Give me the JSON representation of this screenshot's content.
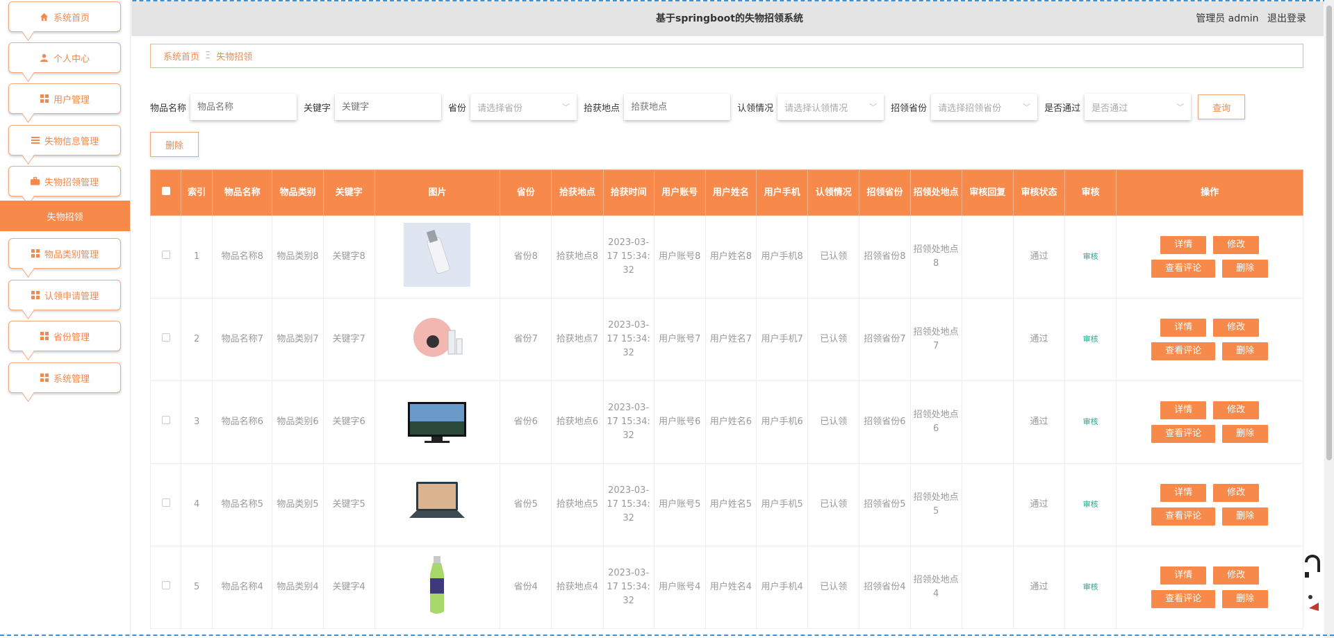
{
  "app": {
    "title": "基于springboot的失物招领系统"
  },
  "header": {
    "user_label": "管理员 admin",
    "logout_label": "退出登录"
  },
  "sidebar": {
    "items": [
      {
        "label": "系统首页",
        "icon": "home-icon"
      },
      {
        "label": "个人中心",
        "icon": "user-icon"
      },
      {
        "label": "用户管理",
        "icon": "grid-icon"
      },
      {
        "label": "失物信息管理",
        "icon": "list-icon"
      },
      {
        "label": "失物招领管理",
        "icon": "briefcase-icon"
      },
      {
        "label": "物品类别管理",
        "icon": "grid-icon"
      },
      {
        "label": "认领申请管理",
        "icon": "grid-icon"
      },
      {
        "label": "省份管理",
        "icon": "grid-icon"
      },
      {
        "label": "系统管理",
        "icon": "grid-icon"
      }
    ],
    "active_sub": "失物招领"
  },
  "breadcrumb": {
    "home": "系统首页",
    "separator": "Ξ",
    "current": "失物招领"
  },
  "search": {
    "name_label": "物品名称",
    "name_placeholder": "物品名称",
    "keyword_label": "关键字",
    "keyword_placeholder": "关键字",
    "province_label": "省份",
    "province_placeholder": "请选择省份",
    "location_label": "拾获地点",
    "location_placeholder": "拾获地点",
    "claim_label": "认领情况",
    "claim_placeholder": "请选择认领情况",
    "claim_province_label": "招领省份",
    "claim_province_placeholder": "请选择招领省份",
    "pass_label": "是否通过",
    "pass_placeholder": "是否通过",
    "query_button": "查询"
  },
  "actions": {
    "delete_button": "删除"
  },
  "table": {
    "headers": [
      "索引",
      "物品名称",
      "物品类别",
      "关键字",
      "图片",
      "省份",
      "拾获地点",
      "拾获时间",
      "用户账号",
      "用户姓名",
      "用户手机",
      "认领情况",
      "招领省份",
      "招领处地点",
      "审核回复",
      "审核状态",
      "审核",
      "操作"
    ],
    "audit_link": "审核",
    "op_labels": {
      "detail": "详情",
      "edit": "修改",
      "comments": "查看评论",
      "delete": "删除"
    },
    "rows": [
      {
        "index": "1",
        "name": "物品名称8",
        "category": "物品类别8",
        "keyword": "关键字8",
        "image": "cosmetic-bottle",
        "province": "省份8",
        "location": "拾获地点8",
        "time": "2023-03-17 15:34:32",
        "account": "用户账号8",
        "username": "用户姓名8",
        "phone": "用户手机8",
        "claim": "已认领",
        "claim_province": "招领省份8",
        "claim_place": "招领处地点8",
        "reply": "",
        "status": "通过"
      },
      {
        "index": "2",
        "name": "物品名称7",
        "category": "物品类别7",
        "keyword": "关键字7",
        "image": "cosmetic-set",
        "province": "省份7",
        "location": "拾获地点7",
        "time": "2023-03-17 15:34:32",
        "account": "用户账号7",
        "username": "用户姓名7",
        "phone": "用户手机7",
        "claim": "已认领",
        "claim_province": "招领省份7",
        "claim_place": "招领处地点7",
        "reply": "",
        "status": "通过"
      },
      {
        "index": "3",
        "name": "物品名称6",
        "category": "物品类别6",
        "keyword": "关键字6",
        "image": "monitor",
        "province": "省份6",
        "location": "拾获地点6",
        "time": "2023-03-17 15:34:32",
        "account": "用户账号6",
        "username": "用户姓名6",
        "phone": "用户手机6",
        "claim": "已认领",
        "claim_province": "招领省份6",
        "claim_place": "招领处地点6",
        "reply": "",
        "status": "通过"
      },
      {
        "index": "4",
        "name": "物品名称5",
        "category": "物品类别5",
        "keyword": "关键字5",
        "image": "laptop",
        "province": "省份5",
        "location": "拾获地点5",
        "time": "2023-03-17 15:34:32",
        "account": "用户账号5",
        "username": "用户姓名5",
        "phone": "用户手机5",
        "claim": "已认领",
        "claim_province": "招领省份5",
        "claim_place": "招领处地点5",
        "reply": "",
        "status": "通过"
      },
      {
        "index": "5",
        "name": "物品名称4",
        "category": "物品类别4",
        "keyword": "关键字4",
        "image": "drink-bottle",
        "province": "省份4",
        "location": "拾获地点4",
        "time": "2023-03-17 15:34:32",
        "account": "用户账号4",
        "username": "用户姓名4",
        "phone": "用户手机4",
        "claim": "已认领",
        "claim_province": "招领省份4",
        "claim_place": "招领处地点4",
        "reply": "",
        "status": "通过"
      }
    ]
  },
  "colors": {
    "accent": "#f7894a",
    "accent_border": "#f3a77f",
    "audit_green": "#2aa88a",
    "header_bg": "#e4e4e4"
  }
}
